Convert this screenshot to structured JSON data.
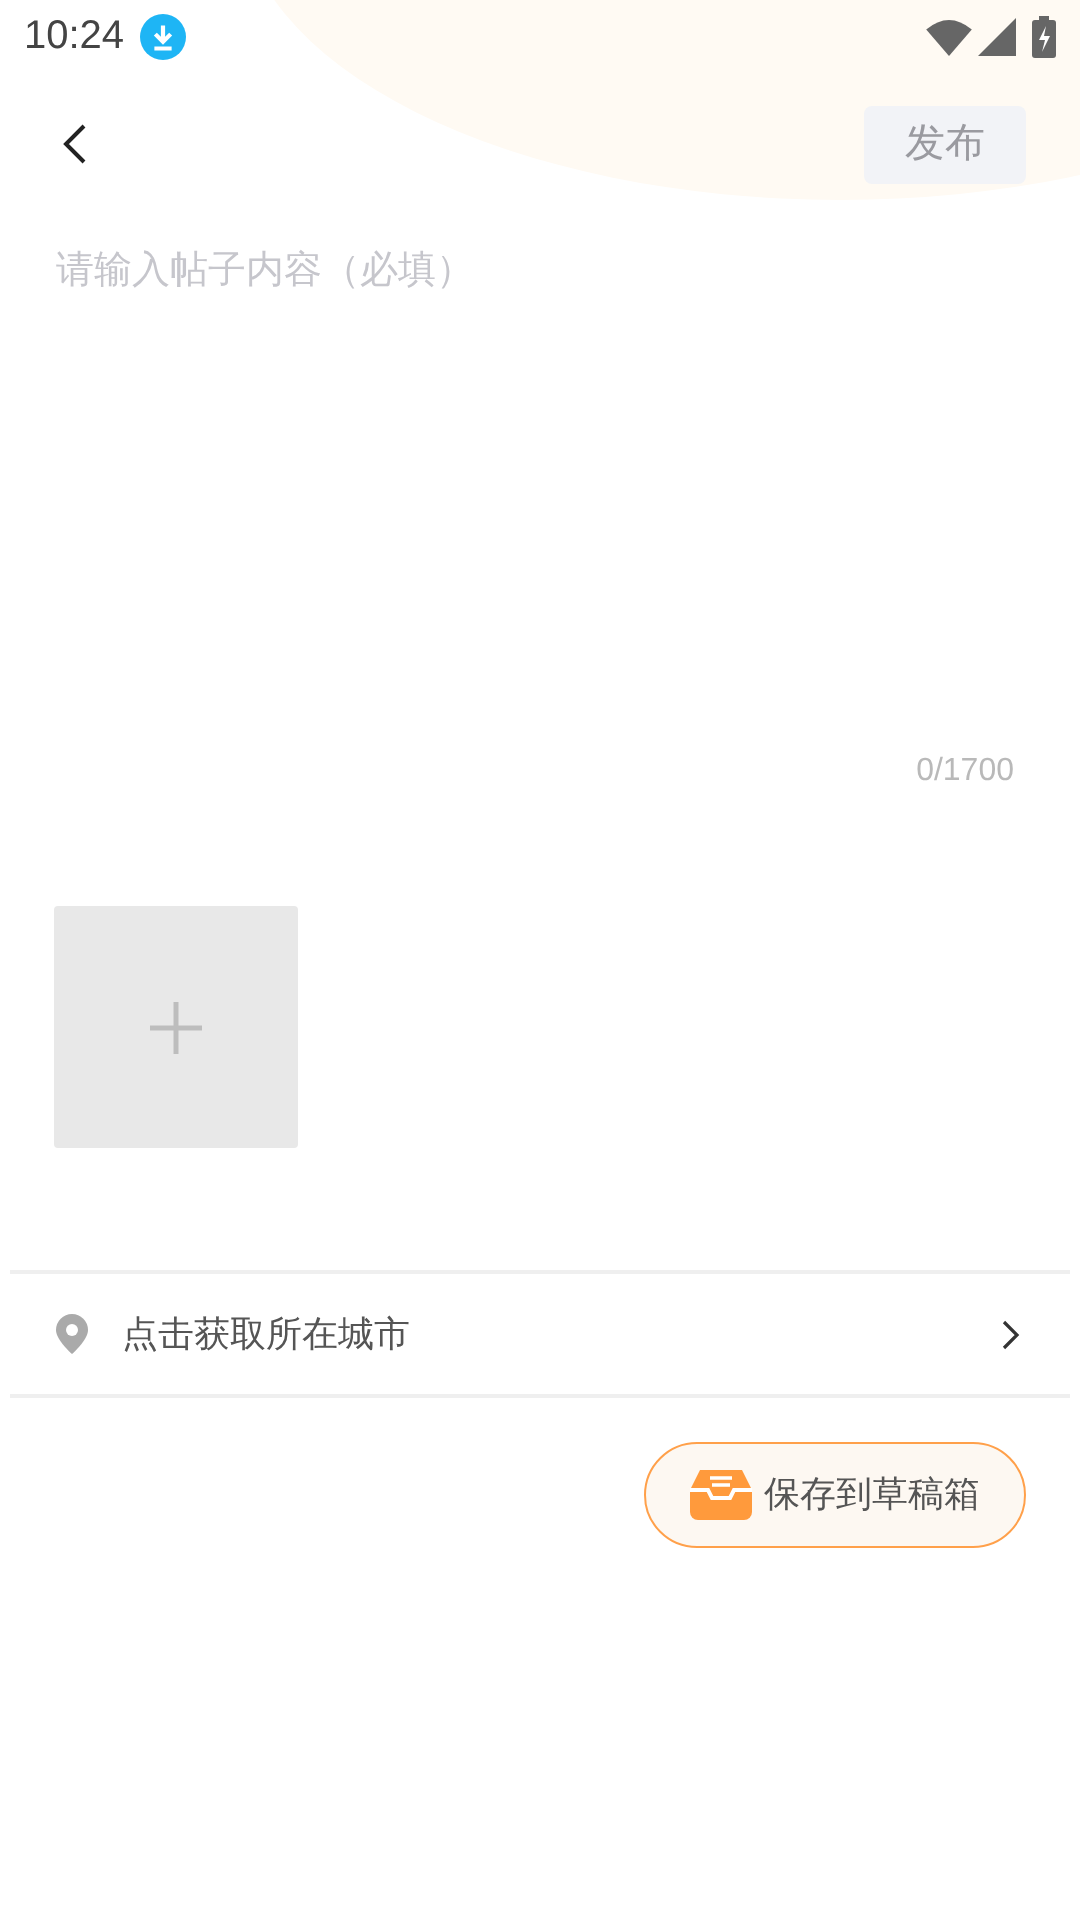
{
  "status_bar": {
    "time": "10:24"
  },
  "header": {
    "publish_button": {
      "label": "发布",
      "disabled": true
    }
  },
  "editor": {
    "placeholder": "请输入帖子内容（必填）",
    "counter": "0/1700"
  },
  "location": {
    "label": "点击获取所在城市"
  },
  "draft_button": {
    "label": "保存到草稿箱"
  }
}
